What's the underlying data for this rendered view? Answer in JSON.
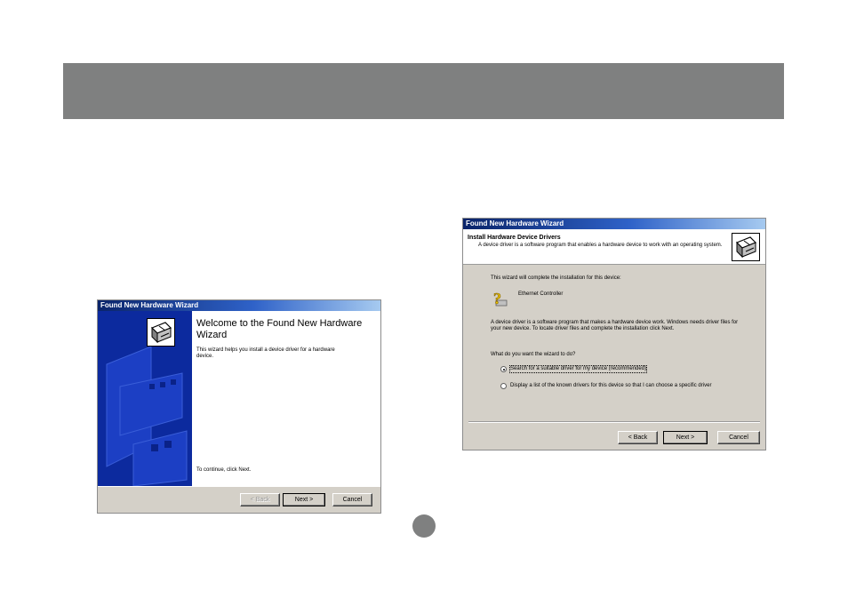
{
  "dialog_welcome": {
    "title": "Found New Hardware Wizard",
    "heading": "Welcome to the Found New Hardware Wizard",
    "body": "This wizard helps you install a device driver for a hardware device.",
    "footer": "To continue, click Next.",
    "buttons": {
      "back": "< Back",
      "next": "Next >",
      "cancel": "Cancel"
    },
    "icon": "hardware-wizard-icon"
  },
  "dialog_install": {
    "title": "Found New Hardware Wizard",
    "heading": "Install Hardware Device Drivers",
    "subheading": "A device driver is a software program that enables a hardware device to work with an operating system.",
    "intro": "This wizard will complete the installation for this device:",
    "device_name": "Ethernet Controller",
    "explanation": "A device driver is a software program that makes a hardware device work. Windows needs driver files for your new device. To locate driver files and complete the installation click Next.",
    "question": "What do you want the wizard to do?",
    "options": [
      {
        "label": "Search for a suitable driver for my device (recommended)",
        "selected": true
      },
      {
        "label": "Display a list of the known drivers for this device so that I can choose a specific driver",
        "selected": false
      }
    ],
    "buttons": {
      "back": "< Back",
      "next": "Next >",
      "cancel": "Cancel"
    },
    "icon": "hardware-wizard-icon",
    "device_icon": "question-device-icon"
  },
  "colors": {
    "header_band": "#7f8080",
    "titlebar_start": "#0a246a",
    "titlebar_end": "#a6caf0",
    "dialog_face": "#d4d0c8",
    "wizard_art": "#0c2a9e"
  }
}
